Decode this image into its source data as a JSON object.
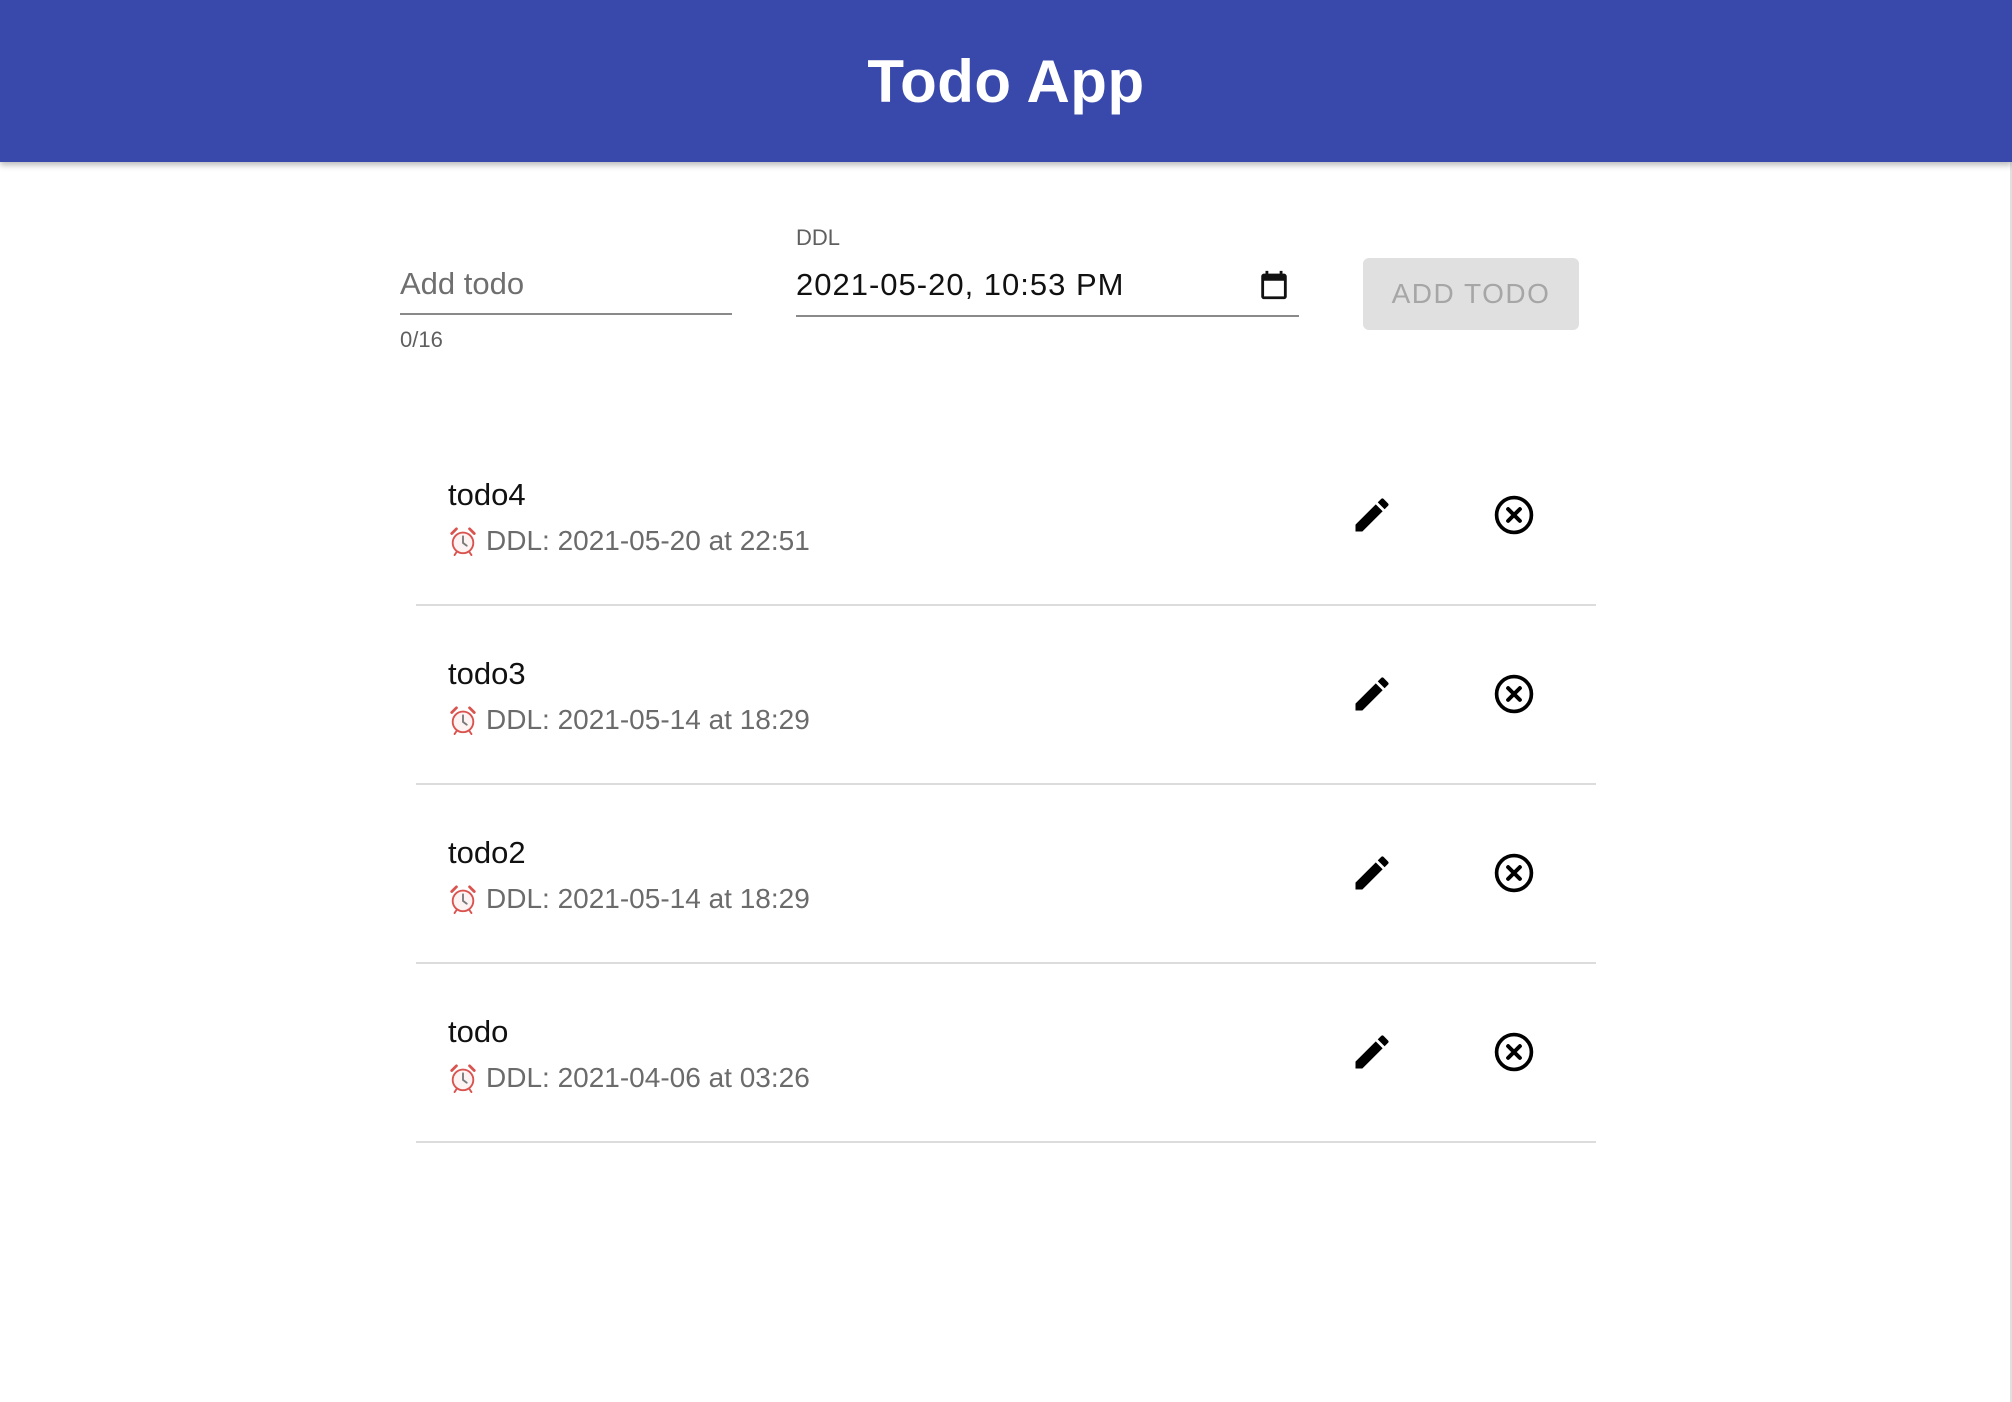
{
  "app": {
    "title": "Todo App",
    "bar_color": "#3949ab"
  },
  "form": {
    "todo_input": {
      "value": "",
      "placeholder": "Add todo",
      "counter": "0/16"
    },
    "ddl_input": {
      "label": "DDL",
      "value": "2021-05-20, 10:53 PM",
      "icon": "calendar-icon"
    },
    "add_button": {
      "label": "ADD TODO",
      "disabled": true
    }
  },
  "todos": [
    {
      "name": "todo4",
      "ddl": "DDL: 2021-05-20 at 22:51",
      "icons": [
        "alarm-clock-icon",
        "edit-icon",
        "delete-icon"
      ]
    },
    {
      "name": "todo3",
      "ddl": "DDL: 2021-05-14 at 18:29",
      "icons": [
        "alarm-clock-icon",
        "edit-icon",
        "delete-icon"
      ]
    },
    {
      "name": "todo2",
      "ddl": "DDL: 2021-05-14 at 18:29",
      "icons": [
        "alarm-clock-icon",
        "edit-icon",
        "delete-icon"
      ]
    },
    {
      "name": "todo",
      "ddl": "DDL: 2021-04-06 at 03:26",
      "icons": [
        "alarm-clock-icon",
        "edit-icon",
        "delete-icon"
      ]
    }
  ]
}
